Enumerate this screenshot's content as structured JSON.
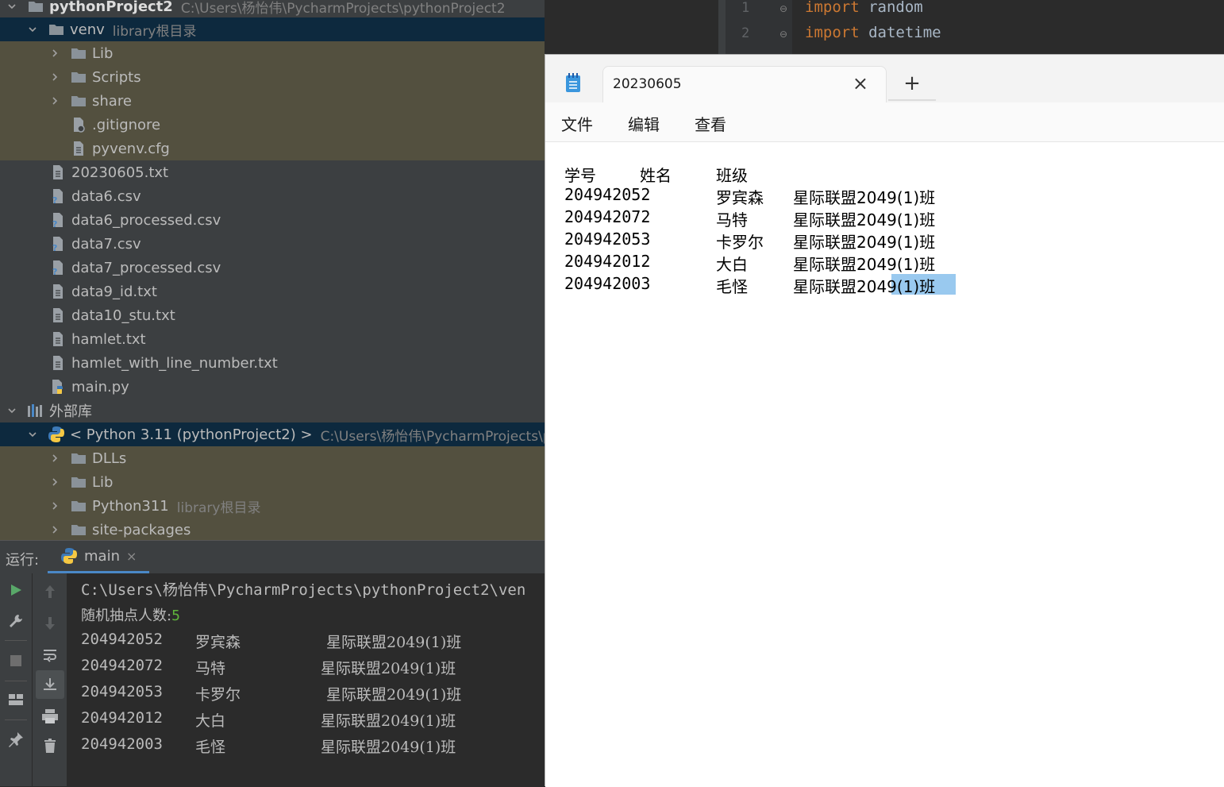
{
  "project_tree": {
    "root": {
      "name": "pythonProject2",
      "path": "C:\\Users\\杨怡伟\\PycharmProjects\\pythonProject2"
    },
    "venv": {
      "name": "venv",
      "hint": "library根目录"
    },
    "venv_children": [
      "Lib",
      "Scripts",
      "share"
    ],
    "venv_files": [
      ".gitignore",
      "pyvenv.cfg"
    ],
    "files": [
      "20230605.txt",
      "data6.csv",
      "data6_processed.csv",
      "data7.csv",
      "data7_processed.csv",
      "data9_id.txt",
      "data10_stu.txt",
      "hamlet.txt",
      "hamlet_with_line_number.txt",
      "main.py"
    ],
    "external": {
      "name": "外部库"
    },
    "python_sdk": {
      "name": "< Python 3.11 (pythonProject2) >",
      "path": "C:\\Users\\杨怡伟\\PycharmProjects\\p"
    },
    "sdk_children": [
      {
        "name": "DLLs",
        "hint": ""
      },
      {
        "name": "Lib",
        "hint": ""
      },
      {
        "name": "Python311",
        "hint": "library根目录"
      },
      {
        "name": "site-packages",
        "hint": ""
      }
    ]
  },
  "editor": {
    "lines": [
      {
        "number": "1",
        "keyword": "import",
        "rest": " random"
      },
      {
        "number": "2",
        "keyword": "import",
        "rest": " datetime"
      }
    ]
  },
  "run_panel": {
    "label": "运行:",
    "tab": "main",
    "tab_close": "×",
    "command": "C:\\Users\\杨怡伟\\PycharmProjects\\pythonProject2\\ven",
    "prompt": "随机抽点人数:",
    "prompt_value": "5",
    "rows": [
      {
        "id": "204942052",
        "name": "罗宾森",
        "cls": "星际联盟2049(1)班"
      },
      {
        "id": "204942072",
        "name": "马特",
        "cls": "星际联盟2049(1)班"
      },
      {
        "id": "204942053",
        "name": "卡罗尔",
        "cls": "星际联盟2049(1)班"
      },
      {
        "id": "204942012",
        "name": "大白",
        "cls": "星际联盟2049(1)班"
      },
      {
        "id": "204942003",
        "name": "毛怪",
        "cls": "星际联盟2049(1)班"
      }
    ]
  },
  "notepad": {
    "tab_title": "20230605",
    "close": "×",
    "new_tab": "+",
    "menu": [
      "文件",
      "编辑",
      "查看"
    ],
    "header": [
      "学号",
      "姓名",
      "班级"
    ],
    "rows": [
      {
        "id": "204942052",
        "name": "罗宾森",
        "cls": "星际联盟2049(1)班"
      },
      {
        "id": "204942072",
        "name": "马特",
        "cls": "星际联盟2049(1)班"
      },
      {
        "id": "204942053",
        "name": "卡罗尔",
        "cls": "星际联盟2049(1)班"
      },
      {
        "id": "204942012",
        "name": "大白",
        "cls": "星际联盟2049(1)班"
      },
      {
        "id": "204942003",
        "name": "毛怪",
        "cls": "星际联盟2049(1)班"
      }
    ]
  }
}
